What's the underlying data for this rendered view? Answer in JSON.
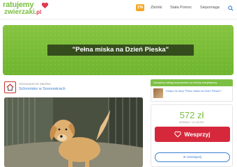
{
  "header": {
    "logo_line1": "ratuje",
    "logo_line1_tail": "my",
    "logo_line2": "zwierzaki",
    "logo_tld": ".pl",
    "gift_label": "1%",
    "nav": [
      "Zbiórki",
      "Stała Pomoc",
      "Siepomaga"
    ]
  },
  "hero": {
    "title": "\"Pełna miska na Dzień Pieska\"",
    "accent": "#7bc043"
  },
  "organizer": {
    "caption": "ORGANIZATOR ZBIÓRKI",
    "name": "Schronisko w Sosnowicach"
  },
  "sidebar": {
    "banner": "Darowizny trafiają bezpośrednio na zbiórkę charytatywną",
    "item_text": "Dołącz do akcji \"Pełna miska na Dzień Pieska\"!"
  },
  "fundraiser": {
    "amount": "572 zł",
    "amount_caption": "WSPARŁY 13 OSOBY",
    "support_label": "Wesprzyj",
    "share_label": "Udostępnij",
    "button_color": "#d6283b"
  }
}
